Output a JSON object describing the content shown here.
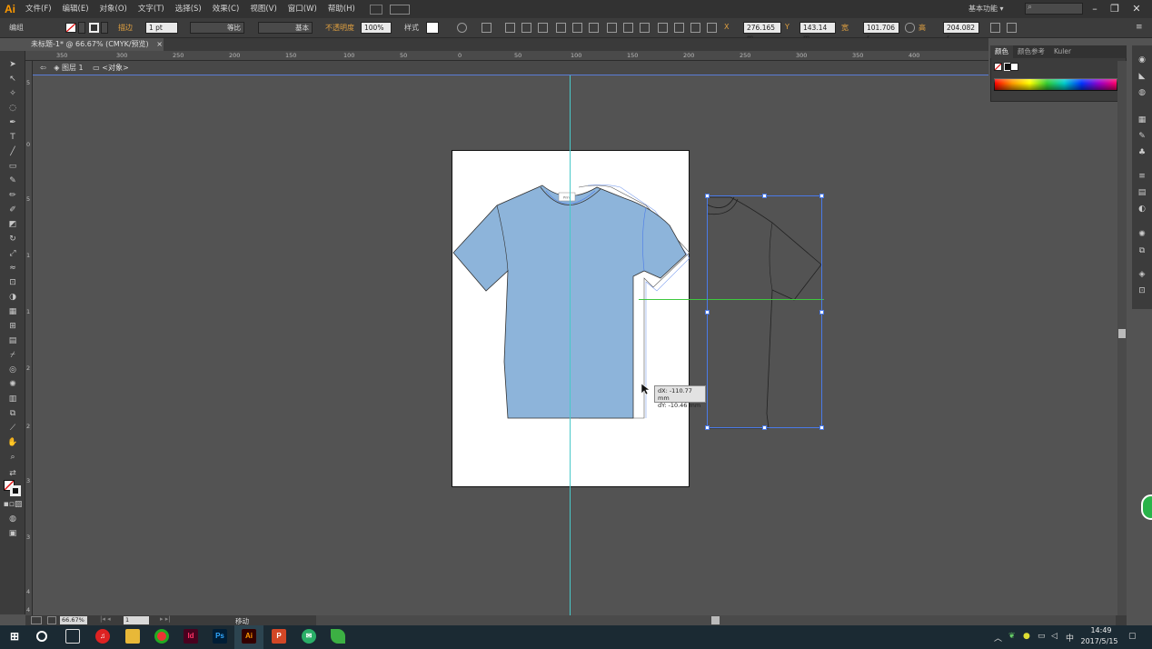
{
  "app": {
    "logo": "Ai"
  },
  "menu": [
    "文件(F)",
    "编辑(E)",
    "对象(O)",
    "文字(T)",
    "选择(S)",
    "效果(C)",
    "视图(V)",
    "窗口(W)",
    "帮助(H)"
  ],
  "workspace": "基本功能",
  "window_controls": {
    "minimize": "–",
    "restore": "❐",
    "close": "✕"
  },
  "control_bar": {
    "selection_label": "编组",
    "stroke_label": "描边",
    "stroke_weight": "1 pt",
    "stroke_profile": "等比",
    "brush": "基本",
    "opacity_label": "不透明度",
    "opacity_value": "100%",
    "style_label": "样式",
    "x_value": "276.165 m",
    "y_value": "143.14 m",
    "w_label": "宽",
    "w_value": "101.706 r",
    "h_label": "高",
    "h_value": "204.082 r"
  },
  "document": {
    "tab_title": "未标题-1* @ 66.67% (CMYK/预览)",
    "close": "×"
  },
  "breadcrumb": {
    "layer": "图层 1",
    "object": "<对象>"
  },
  "ruler_h": [
    "350",
    "300",
    "250",
    "200",
    "150",
    "100",
    "50",
    "0",
    "50",
    "100",
    "150",
    "200",
    "250",
    "300",
    "350",
    "400"
  ],
  "ruler_v": [
    "5",
    "0",
    "5",
    "1",
    "1",
    "2",
    "2",
    "3",
    "3",
    "4",
    "4"
  ],
  "tooltip": {
    "dx": "dX: -110.77 mm",
    "dy": "dY: -10.46 mm"
  },
  "shirt_label": "Print",
  "panel": {
    "tabs": [
      "颜色",
      "颜色参考",
      "Kuler"
    ]
  },
  "status": {
    "zoom": "66.67%",
    "page": "1",
    "tool": "移动"
  },
  "taskbar": {
    "time": "14:49",
    "date": "2017/5/15",
    "ime": "中"
  },
  "colors": {
    "accent_blue": "#4a7ae8",
    "guide_cyan": "#49c9c9",
    "guide_green": "#3ec83e",
    "shirt_fill": "#8db4da",
    "ai_orange": "#ff9a00"
  }
}
